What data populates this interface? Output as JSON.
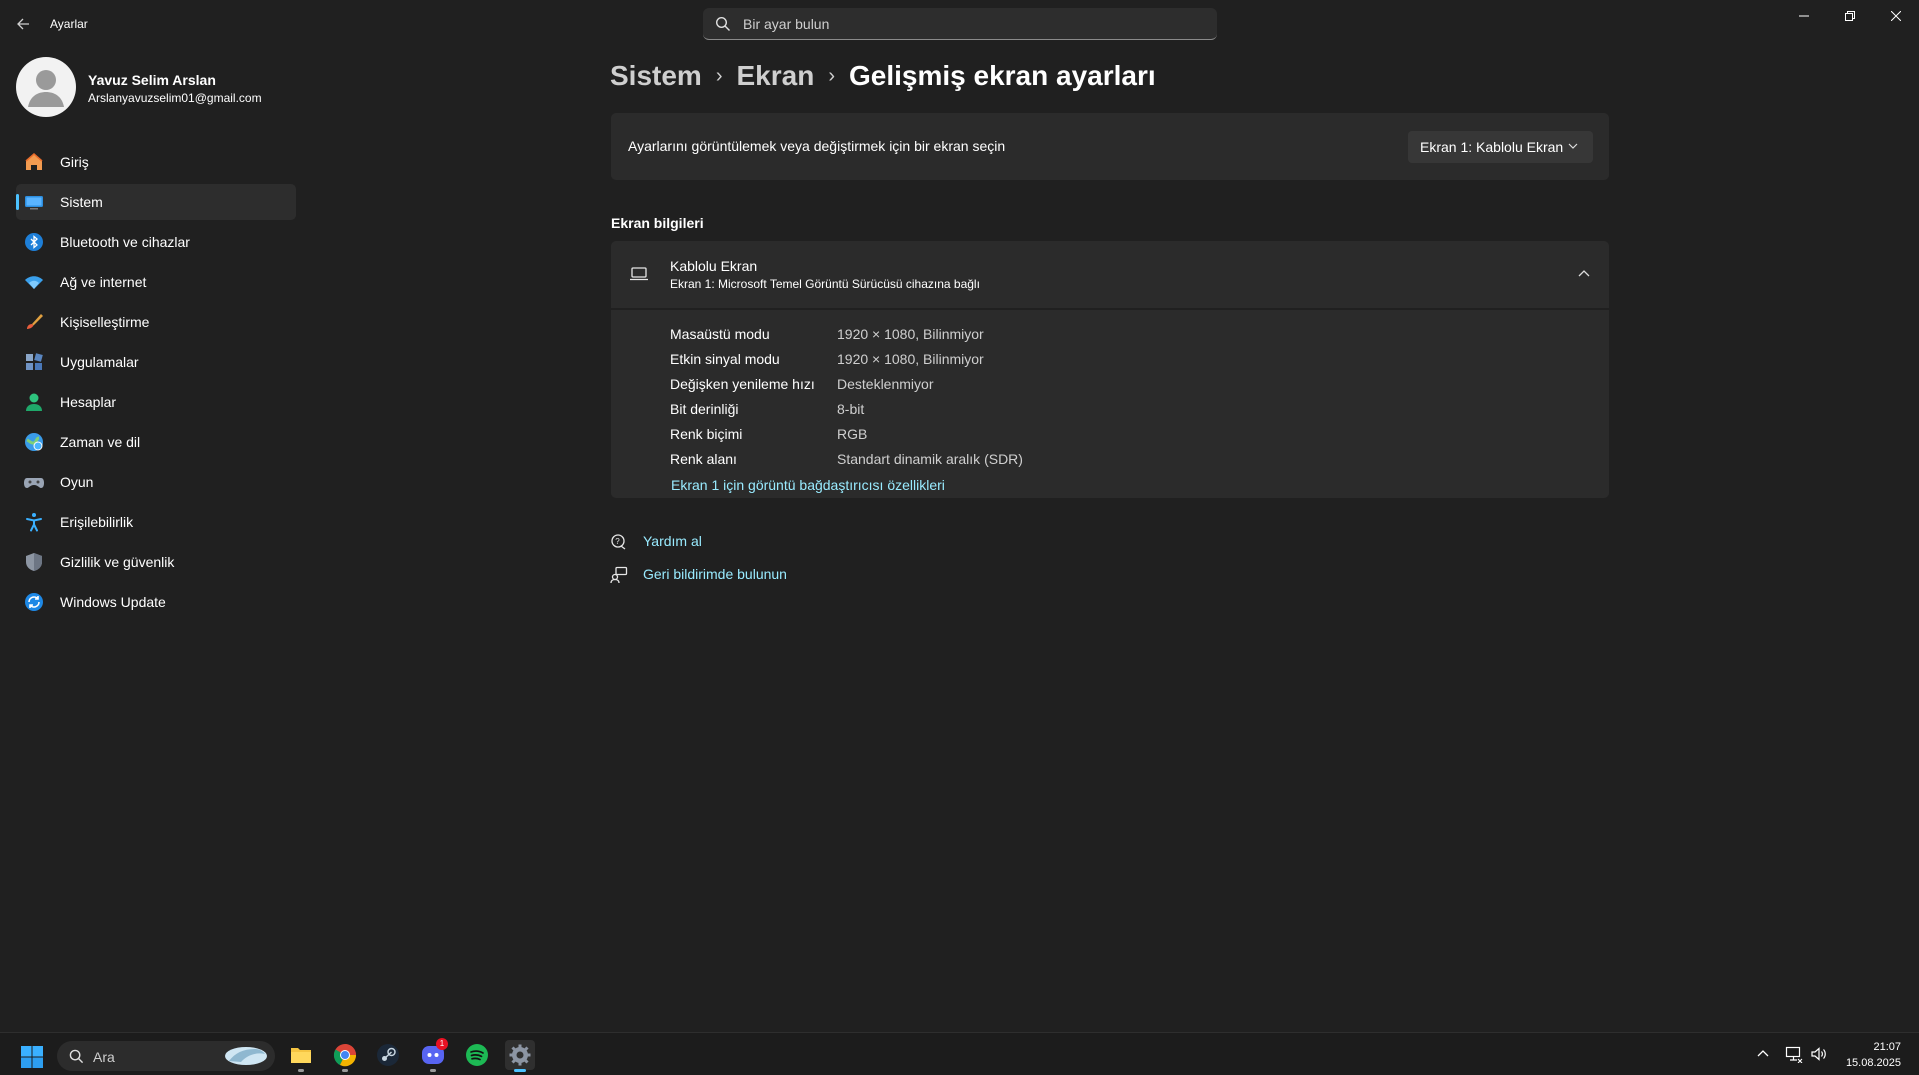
{
  "window": {
    "app_title": "Ayarlar",
    "search_placeholder": "Bir ayar bulun"
  },
  "profile": {
    "name": "Yavuz Selim Arslan",
    "email": "Arslanyavuzselim01@gmail.com"
  },
  "nav": {
    "items": [
      {
        "label": "Giriş",
        "icon": "home-icon"
      },
      {
        "label": "Sistem",
        "icon": "system-icon",
        "active": true
      },
      {
        "label": "Bluetooth ve cihazlar",
        "icon": "bluetooth-icon"
      },
      {
        "label": "Ağ ve internet",
        "icon": "wifi-icon"
      },
      {
        "label": "Kişiselleştirme",
        "icon": "brush-icon"
      },
      {
        "label": "Uygulamalar",
        "icon": "apps-icon"
      },
      {
        "label": "Hesaplar",
        "icon": "accounts-icon"
      },
      {
        "label": "Zaman ve dil",
        "icon": "time-language-icon"
      },
      {
        "label": "Oyun",
        "icon": "gamepad-icon"
      },
      {
        "label": "Erişilebilirlik",
        "icon": "accessibility-icon"
      },
      {
        "label": "Gizlilik ve güvenlik",
        "icon": "shield-icon"
      },
      {
        "label": "Windows Update",
        "icon": "update-icon"
      }
    ]
  },
  "breadcrumb": [
    "Sistem",
    "Ekran",
    "Gelişmiş ekran ayarları"
  ],
  "display_select": {
    "prompt": "Ayarlarını görüntülemek veya değiştirmek için bir ekran seçin",
    "selected": "Ekran 1: Kablolu Ekran"
  },
  "display_info": {
    "section_title": "Ekran bilgileri",
    "title": "Kablolu Ekran",
    "subtitle": "Ekran 1: Microsoft Temel Görüntü Sürücüsü cihazına bağlı",
    "rows": [
      {
        "label": "Masaüstü modu",
        "value": "1920 × 1080, Bilinmiyor"
      },
      {
        "label": "Etkin sinyal modu",
        "value": "1920 × 1080, Bilinmiyor"
      },
      {
        "label": "Değişken yenileme hızı",
        "value": "Desteklenmiyor"
      },
      {
        "label": "Bit derinliği",
        "value": "8-bit"
      },
      {
        "label": "Renk biçimi",
        "value": "RGB"
      },
      {
        "label": "Renk alanı",
        "value": "Standart dinamik aralık (SDR)"
      }
    ],
    "adapter_link": "Ekran 1 için görüntü bağdaştırıcısı özellikleri"
  },
  "help": {
    "get_help": "Yardım al",
    "feedback": "Geri bildirimde bulunun"
  },
  "taskbar": {
    "search_placeholder": "Ara",
    "discord_badge": "1",
    "time": "21:07",
    "date": "15.08.2025"
  },
  "colors": {
    "accent": "#4cc2ff",
    "link": "#99ebff",
    "background": "#202020",
    "card": "#2b2b2b"
  }
}
